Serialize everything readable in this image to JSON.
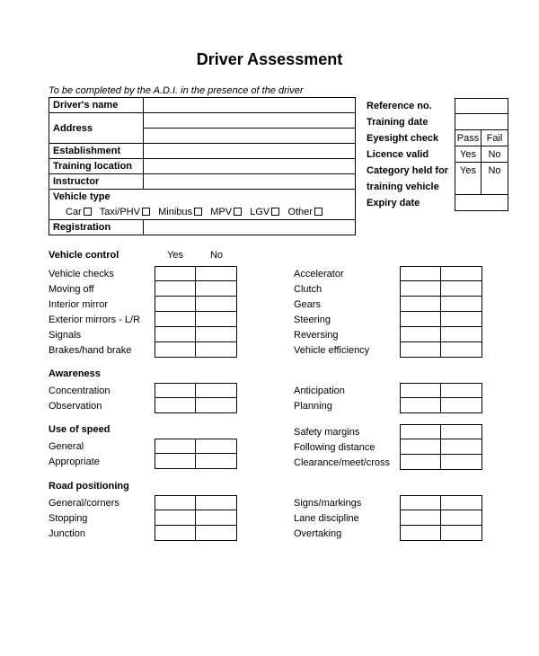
{
  "title": "Driver Assessment",
  "instruction": "To be completed by the A.D.I. in the presence of the driver",
  "left_fields": {
    "drivers_name": "Driver's name",
    "address": "Address",
    "establishment": "Establishment",
    "training_location": "Training location",
    "instructor": "Instructor",
    "vehicle_type": "Vehicle type",
    "registration": "Registration"
  },
  "vehicle_types": [
    "Car",
    "Taxi/PHV",
    "Minibus",
    "MPV",
    "LGV",
    "Other"
  ],
  "meta": {
    "reference_no": "Reference no.",
    "training_date": "Training date",
    "eyesight_check": "Eyesight check",
    "licence_valid": "Licence valid",
    "category_held": "Category held for",
    "training_vehicle": "training vehicle",
    "expiry_date": "Expiry date",
    "pass": "Pass",
    "fail": "Fail",
    "yes": "Yes",
    "no": "No"
  },
  "yesno": {
    "yes": "Yes",
    "no": "No"
  },
  "sections": {
    "vehicle_control": {
      "title": "Vehicle control",
      "left": [
        "Vehicle checks",
        "Moving off",
        "Interior mirror",
        "Exterior mirrors - L/R",
        "Signals",
        "Brakes/hand brake"
      ],
      "right": [
        "Accelerator",
        "Clutch",
        "Gears",
        "Steering",
        "Reversing",
        "Vehicle efficiency"
      ]
    },
    "awareness": {
      "title": "Awareness",
      "left": [
        "Concentration",
        "Observation"
      ],
      "right": [
        "Anticipation",
        "Planning"
      ]
    },
    "use_of_speed": {
      "title": "Use of speed",
      "left": [
        "General",
        "Appropriate"
      ],
      "right_hdr": "Safety margins",
      "right": [
        "Following distance",
        "Clearance/meet/cross"
      ]
    },
    "road_positioning": {
      "title": "Road positioning",
      "left": [
        "General/corners",
        "Stopping",
        "Junction"
      ],
      "right": [
        "Signs/markings",
        "Lane discipline",
        "Overtaking"
      ]
    }
  }
}
